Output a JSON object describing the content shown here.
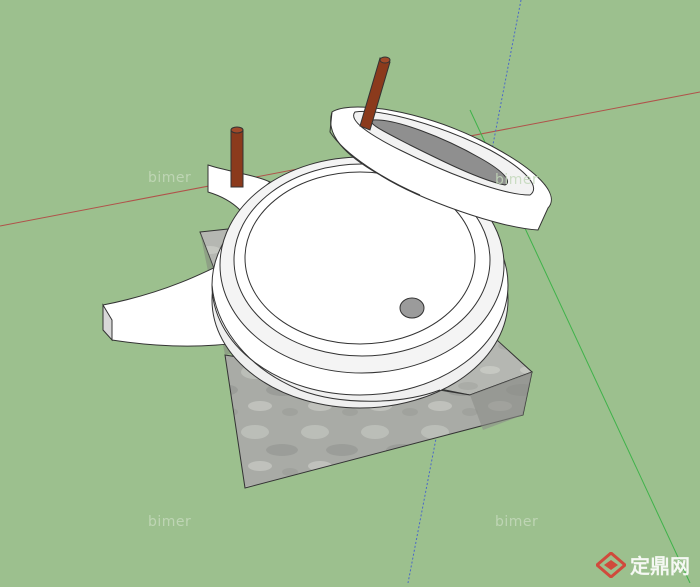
{
  "scene": {
    "background_color": "#9cc08e",
    "object": "stone-mill-model"
  },
  "watermarks": {
    "wm1": "bimer",
    "wm2": "bimer",
    "wm3": "bimer",
    "wm4": "bimer"
  },
  "logo": {
    "text": "定鼎网",
    "icon": "diamond-logo-icon",
    "color": "#d04a3c"
  }
}
